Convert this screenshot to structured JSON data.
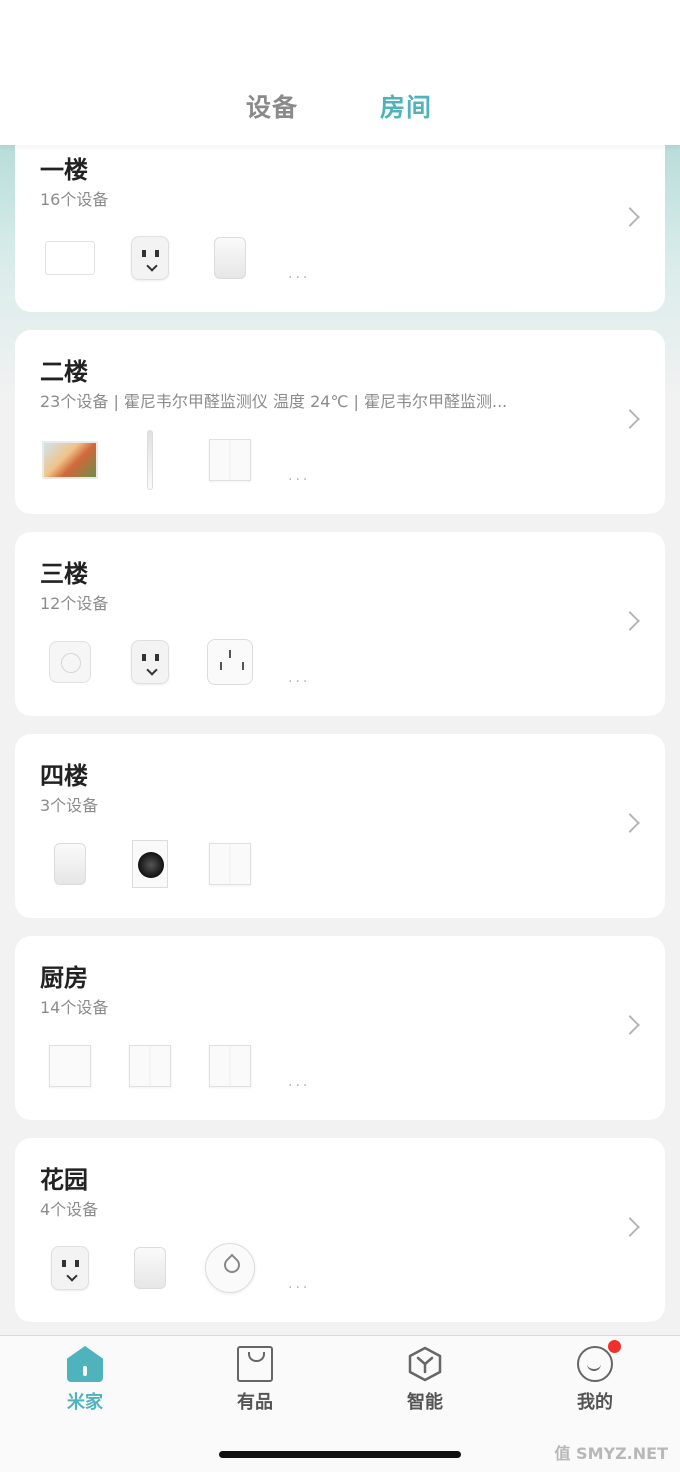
{
  "header": {
    "tabs": [
      {
        "label": "设备",
        "active": false
      },
      {
        "label": "房间",
        "active": true
      }
    ]
  },
  "rooms": [
    {
      "name": "一楼",
      "summary": "16个设备",
      "devices": [
        "panel",
        "smart-plug",
        "motion-sensor"
      ],
      "more": "..."
    },
    {
      "name": "二楼",
      "summary": "23个设备 | 霍尼韦尔甲醛监测仪 温度 24℃ | 霍尼韦尔甲醛监测...",
      "devices": [
        "aquarium",
        "toothbrush",
        "double-switch"
      ],
      "more": "..."
    },
    {
      "name": "三楼",
      "summary": "12个设备",
      "devices": [
        "wireless-button",
        "smart-plug",
        "wall-socket"
      ],
      "more": "..."
    },
    {
      "name": "四楼",
      "summary": "3个设备",
      "devices": [
        "motion-sensor",
        "washing-machine",
        "double-switch"
      ],
      "more": ""
    },
    {
      "name": "厨房",
      "summary": "14个设备",
      "devices": [
        "single-switch",
        "double-switch",
        "double-switch"
      ],
      "more": "..."
    },
    {
      "name": "花园",
      "summary": "4个设备",
      "devices": [
        "smart-plug",
        "motion-sensor",
        "water-leak-sensor"
      ],
      "more": "..."
    }
  ],
  "tabbar": {
    "items": [
      {
        "label": "米家",
        "icon": "home-icon",
        "active": true
      },
      {
        "label": "有品",
        "icon": "shop-bag-icon",
        "active": false
      },
      {
        "label": "智能",
        "icon": "smart-hexagon-icon",
        "active": false
      },
      {
        "label": "我的",
        "icon": "profile-smile-icon",
        "active": false,
        "badge": true
      }
    ]
  },
  "watermark": "值 SMYZ.NET",
  "colors": {
    "accent": "#4fb3bd",
    "badge": "#f0302a"
  }
}
